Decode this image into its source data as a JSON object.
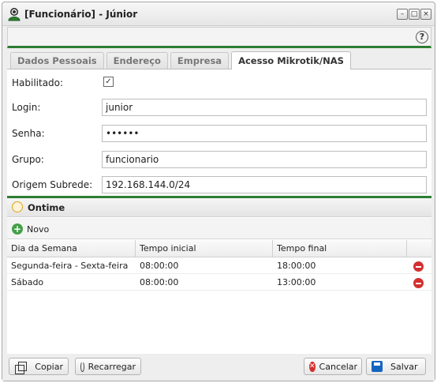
{
  "window": {
    "title": "[Funcionário] - Júnior",
    "controls": [
      "–",
      "□",
      "×"
    ]
  },
  "toolbar": {
    "help_icon": "?"
  },
  "tabs": [
    {
      "label": "Dados Pessoais",
      "active": false
    },
    {
      "label": "Endereço",
      "active": false
    },
    {
      "label": "Empresa",
      "active": false
    },
    {
      "label": "Acesso Mikrotik/NAS",
      "active": true
    }
  ],
  "form": {
    "habilitado": {
      "label": "Habilitado:",
      "checked": true,
      "mark": "✓"
    },
    "login": {
      "label": "Login:",
      "value": "junior"
    },
    "senha": {
      "label": "Senha:",
      "value": "••••••"
    },
    "grupo": {
      "label": "Grupo:",
      "value": "funcionario"
    },
    "origem": {
      "label": "Origem Subrede:",
      "value": "192.168.144.0/24"
    }
  },
  "ontime": {
    "title": "Ontime",
    "novo_label": "Novo",
    "plus_icon": "+",
    "columns": [
      "Dia da Semana",
      "Tempo inicial",
      "Tempo final"
    ],
    "rows": [
      {
        "dia": "Segunda-feira - Sexta-feira",
        "inicio": "08:00:00",
        "fim": "18:00:00"
      },
      {
        "dia": "Sábado",
        "inicio": "08:00:00",
        "fim": "13:00:00"
      }
    ]
  },
  "footer": {
    "copiar": "Copiar",
    "recarregar": "Recarregar",
    "cancelar": "Cancelar",
    "salvar": "Salvar",
    "cancel_icon": "✕"
  },
  "colors": {
    "accent_green": "#2e7d32",
    "delete_red": "#d32f2f",
    "save_blue": "#1565c0"
  }
}
